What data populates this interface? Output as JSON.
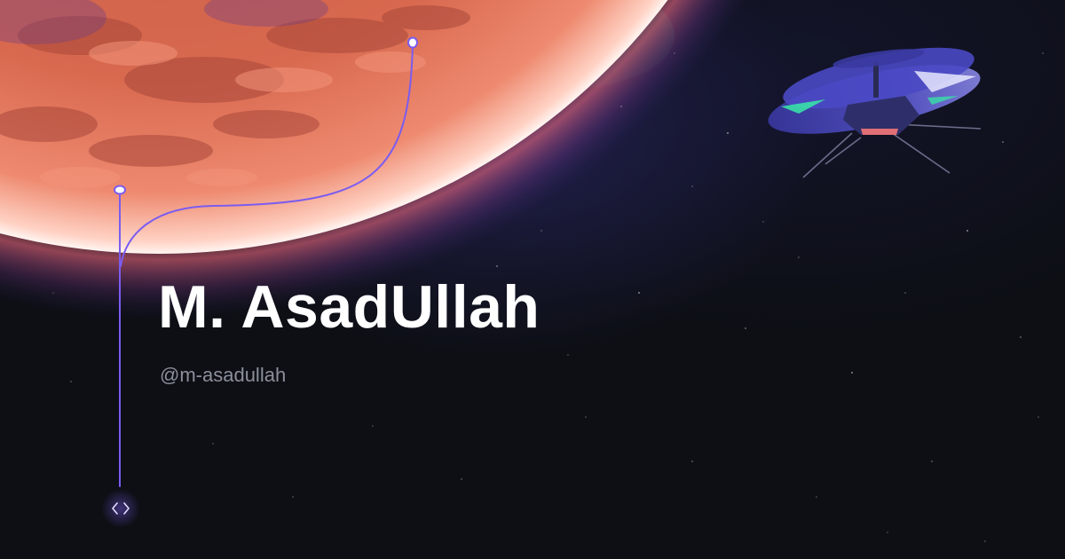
{
  "profile": {
    "name": "M. AsadUllah",
    "handle": "@m-asadullah"
  },
  "icons": {
    "code": "code-brackets-icon",
    "drone": "helicopter-drone-illustration",
    "planet": "mars-planet-illustration"
  },
  "colors": {
    "background": "#0d0f15",
    "title": "#ffffff",
    "handle": "#8b8f9a",
    "accent_line": "#7b5cf0",
    "planet": "#e0715a"
  }
}
